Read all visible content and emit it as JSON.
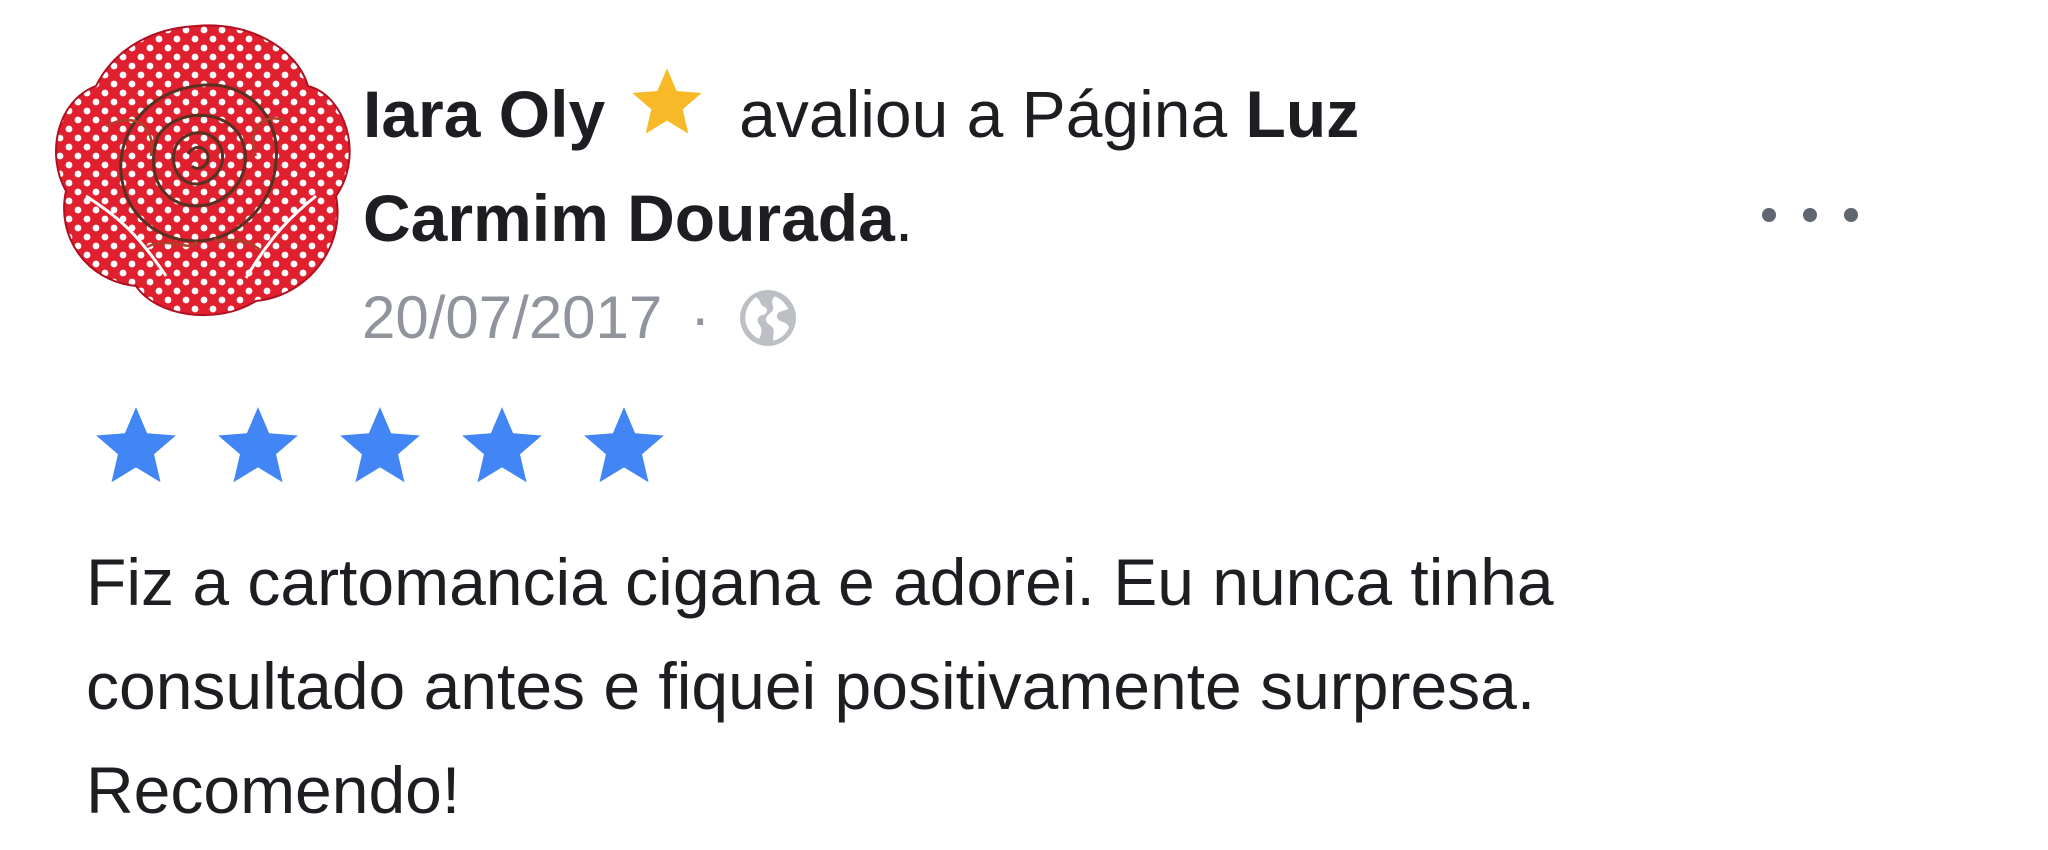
{
  "review_post": {
    "author_name": "Iara Oly",
    "action_text": "avaliou a Página",
    "page_name_line1": "Luz",
    "page_name_line2": "Carmim Dourada",
    "period": ".",
    "date": "20/07/2017",
    "separator": "·",
    "privacy_icon": "globe-icon",
    "badge_icon": "gold-star-icon",
    "menu_icon": "more-options-icon",
    "rating": 5,
    "rating_max": 5,
    "review_lines": [
      "Fiz a cartomancia cigana e adorei.  Eu nunca tinha",
      "consultado antes e fiquei positivamente surpresa.",
      "Recomendo!"
    ]
  },
  "colors": {
    "rating_star": "#4285f4",
    "badge_star": "#f7b928",
    "text_primary": "#1c1e21",
    "text_secondary": "#90949c",
    "avatar_rose": "#e0202f"
  }
}
